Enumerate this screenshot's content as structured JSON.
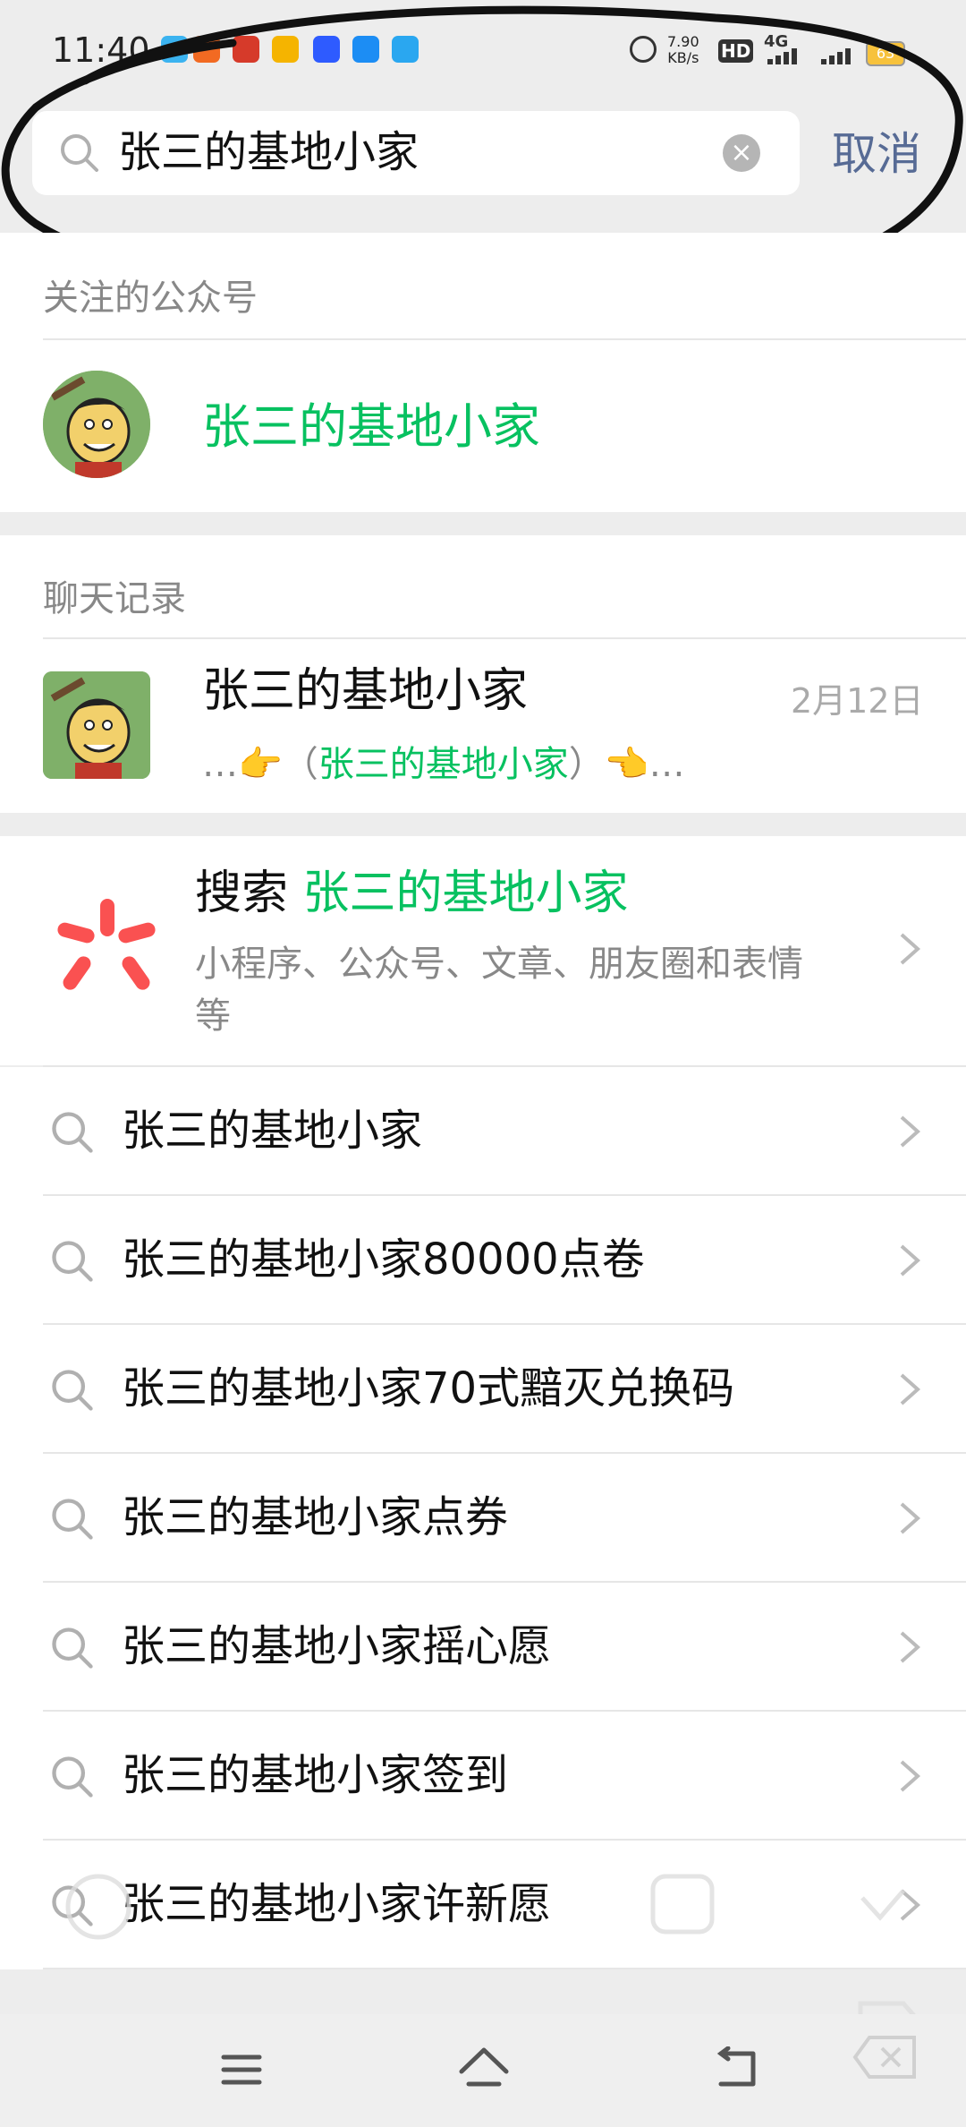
{
  "status_bar": {
    "time": "11:40",
    "net_speed_value": "7.90",
    "net_speed_unit": "KB/s",
    "hd_label": "HD",
    "network_type": "4G",
    "battery_level": "63"
  },
  "search": {
    "query": "张三的基地小家",
    "cancel_label": "取消"
  },
  "official_accounts": {
    "section_title": "关注的公众号",
    "items": [
      {
        "name": "张三的基地小家"
      }
    ]
  },
  "chat_records": {
    "section_title": "聊天记录",
    "items": [
      {
        "name": "张三的基地小家",
        "date": "2月12日",
        "snippet_prefix": "…👉（",
        "snippet_highlight": "张三的基地小家",
        "snippet_suffix": "）👈…"
      }
    ]
  },
  "search_more": {
    "prefix": "搜索",
    "highlight": "张三的基地小家",
    "subtitle": "小程序、公众号、文章、朋友圈和表情等"
  },
  "suggestions": [
    "张三的基地小家",
    "张三的基地小家80000点卷",
    "张三的基地小家70式黯灭兑换码",
    "张三的基地小家点券",
    "张三的基地小家摇心愿",
    "张三的基地小家签到",
    "张三的基地小家许新愿"
  ],
  "colors": {
    "accent_green": "#07c160",
    "link_blue": "#576b95",
    "background": "#ededed"
  }
}
